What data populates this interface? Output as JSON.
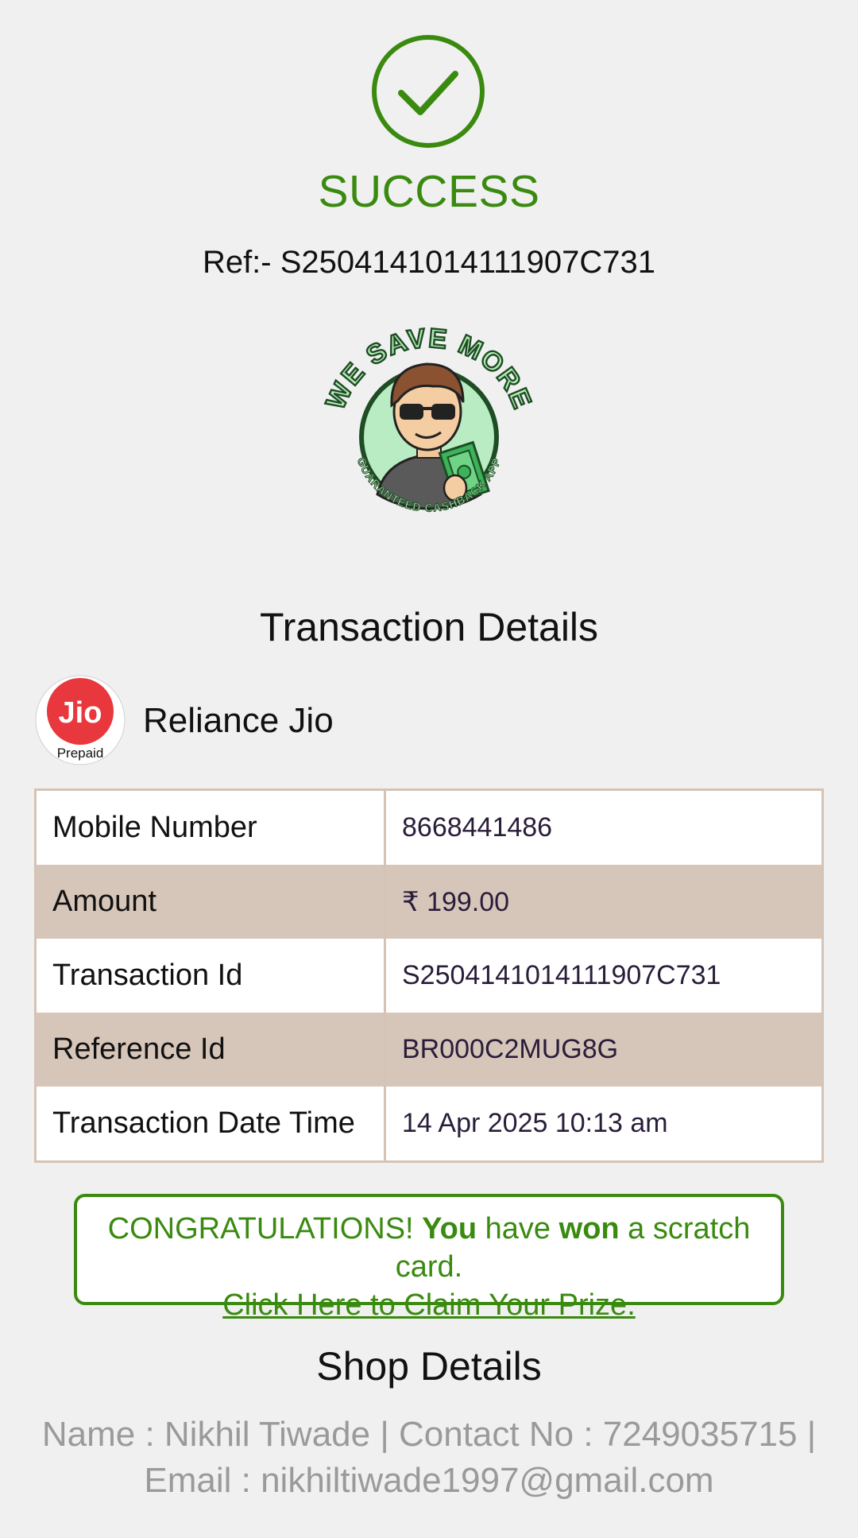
{
  "status": {
    "title": "SUCCESS",
    "ref_label": "Ref:- S2504141014111907C731"
  },
  "logo": {
    "top_text": "WE SAVE MORE",
    "bottom_text": "GUARANTEED CASHBACK APP"
  },
  "transaction": {
    "section_title": "Transaction Details",
    "operator_logo_text": "Jio",
    "operator_logo_sub": "Prepaid",
    "operator_name": "Reliance Jio",
    "rows": [
      {
        "label": "Mobile Number",
        "value": "8668441486"
      },
      {
        "label": "Amount",
        "value": "₹ 199.00"
      },
      {
        "label": "Transaction Id",
        "value": "S2504141014111907C731"
      },
      {
        "label": "Reference Id",
        "value": "BR000C2MUG8G"
      },
      {
        "label": "Transaction Date Time",
        "value": "14 Apr 2025 10:13 am"
      }
    ]
  },
  "promo": {
    "part1": "CONGRATULATIONS! ",
    "part2": "You",
    "part3": " have ",
    "part4": "won",
    "part5": " a scratch card.",
    "link": "Click Here to Claim Your Prize."
  },
  "shop": {
    "section_title": "Shop Details",
    "line1": "Name : Nikhil Tiwade | Contact No : 7249035715 |",
    "line2": "Email : nikhiltiwade1997@gmail.com"
  },
  "colors": {
    "success_green": "#3a8a10",
    "table_alt_row": "#d6c5b9",
    "jio_red": "#e8383d"
  }
}
